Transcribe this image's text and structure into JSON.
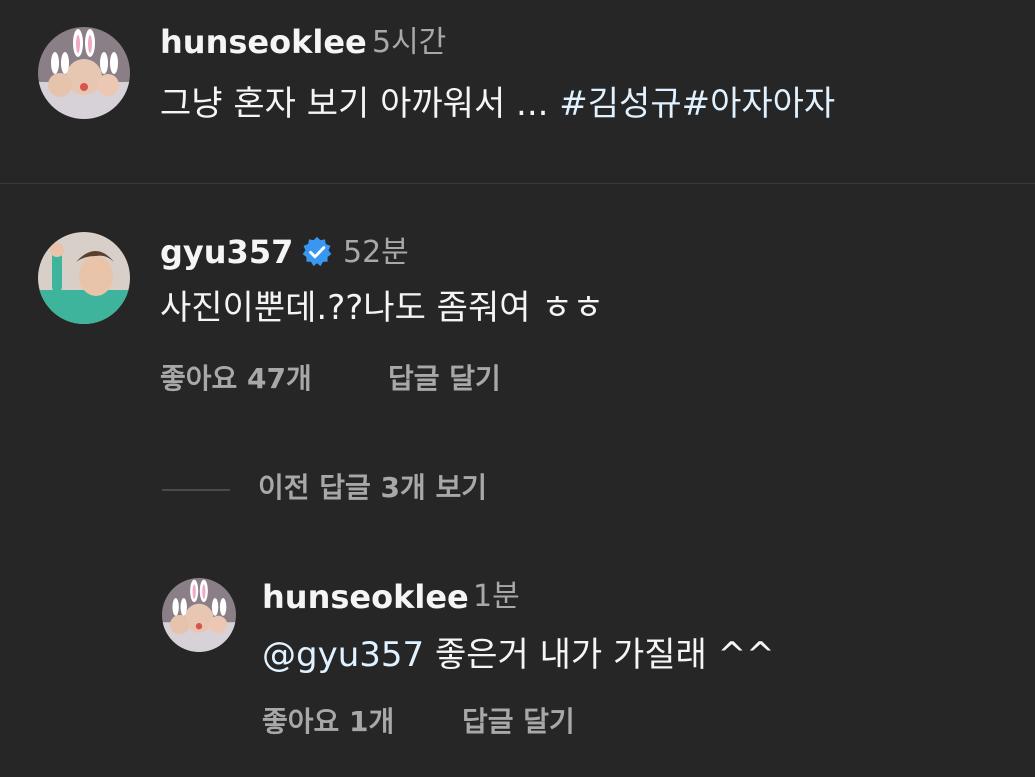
{
  "caption": {
    "username": "hunseoklee",
    "time": "5시간",
    "text": "그냥 혼자 보기 아까워서 ... ",
    "hashtags": "#김성규#아자아자"
  },
  "comment": {
    "username": "gyu357",
    "time": "52분",
    "text": "사진이뿐데.??나도 좀줘여 ㅎㅎ",
    "likes": "좋아요 47개",
    "reply": "답글 달기"
  },
  "view_replies": "이전 답글 3개 보기",
  "reply": {
    "username": "hunseoklee",
    "time": "1분",
    "mention": "@gyu357",
    "text": " 좋은거 내가 가질래 ^^",
    "likes": "좋아요 1개",
    "reply": "답글 달기"
  },
  "colors": {
    "background": "#262626",
    "link": "#e0f1ff",
    "verified": "#3897f0",
    "secondary_text": "#a8a8a8"
  }
}
